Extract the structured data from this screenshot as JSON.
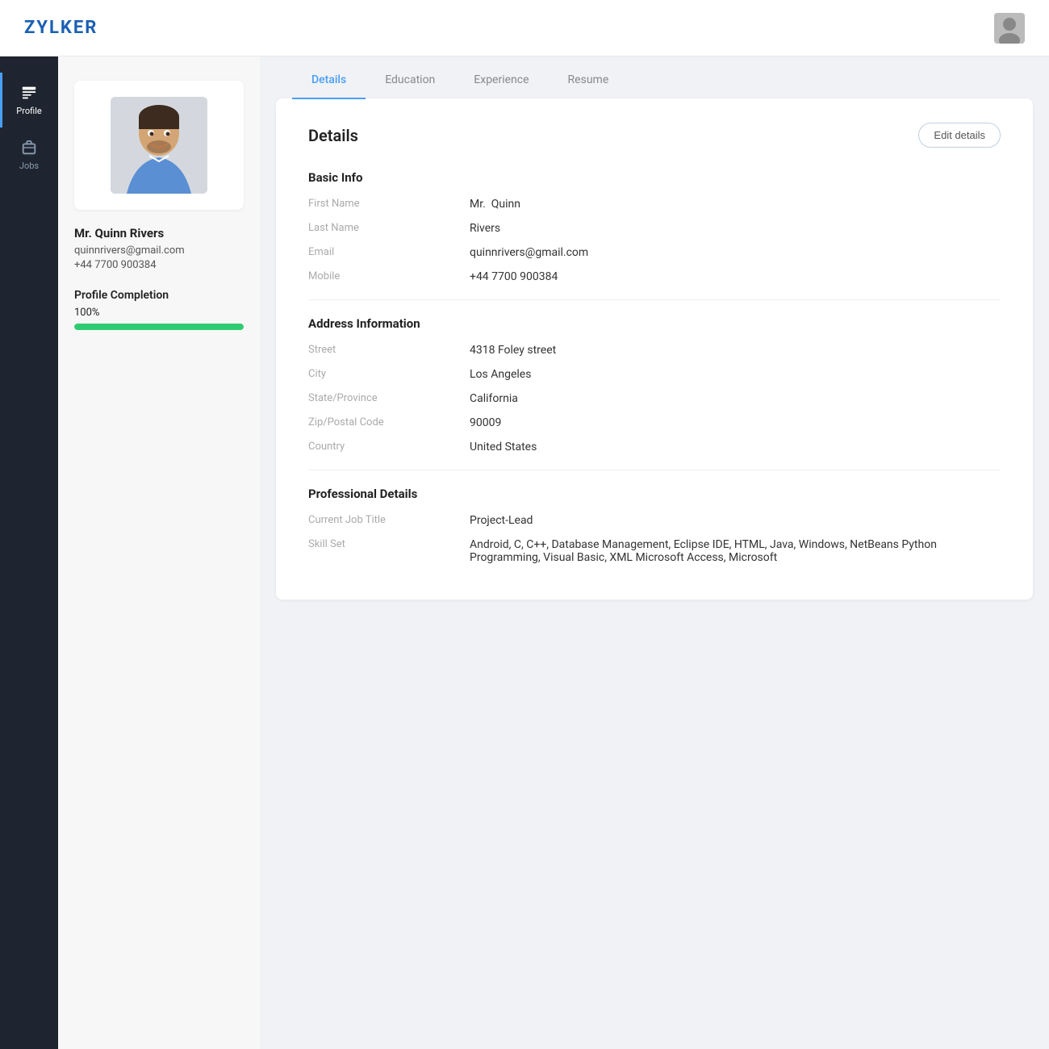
{
  "header": {
    "logo": "ZYLKER"
  },
  "sidebar": {
    "items": [
      {
        "id": "profile",
        "label": "Profile",
        "active": true
      },
      {
        "id": "jobs",
        "label": "Jobs",
        "active": false
      }
    ]
  },
  "left_panel": {
    "name": "Mr. Quinn Rivers",
    "email": "quinnrivers@gmail.com",
    "phone": "+44 7700 900384",
    "completion_label": "Profile Completion",
    "completion_percent": "100%",
    "completion_value": 100
  },
  "tabs": [
    {
      "id": "details",
      "label": "Details",
      "active": true
    },
    {
      "id": "education",
      "label": "Education",
      "active": false
    },
    {
      "id": "experience",
      "label": "Experience",
      "active": false
    },
    {
      "id": "resume",
      "label": "Resume",
      "active": false
    }
  ],
  "details_card": {
    "title": "Details",
    "edit_button": "Edit details",
    "basic_info": {
      "section_title": "Basic Info",
      "fields": [
        {
          "label": "First Name",
          "value": "Mr.  Quinn"
        },
        {
          "label": "Last Name",
          "value": "Rivers"
        },
        {
          "label": "Email",
          "value": "quinnrivers@gmail.com"
        },
        {
          "label": "Mobile",
          "value": "+44 7700 900384"
        }
      ]
    },
    "address_info": {
      "section_title": "Address Information",
      "fields": [
        {
          "label": "Street",
          "value": "4318 Foley street"
        },
        {
          "label": "City",
          "value": "Los Angeles"
        },
        {
          "label": "State/Province",
          "value": "California"
        },
        {
          "label": "Zip/Postal Code",
          "value": "90009"
        },
        {
          "label": "Country",
          "value": "United States"
        }
      ]
    },
    "professional": {
      "section_title": "Professional Details",
      "fields": [
        {
          "label": "Current Job Title",
          "value": "Project-Lead"
        },
        {
          "label": "Skill Set",
          "value": "Android, C, C++, Database Management, Eclipse IDE, HTML, Java, Windows, NetBeans Python Programming, Visual Basic, XML Microsoft Access, Microsoft"
        }
      ]
    }
  }
}
